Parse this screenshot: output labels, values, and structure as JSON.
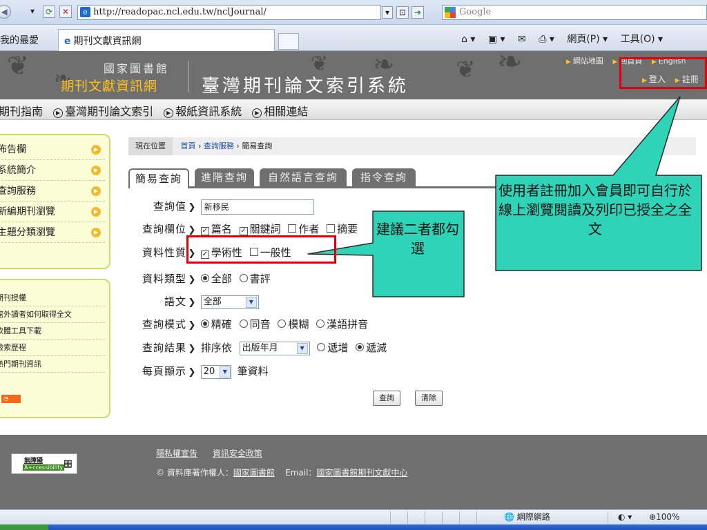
{
  "browser": {
    "url": "http://readopac.ncl.edu.tw/nclJournal/",
    "search_placeholder": "Google",
    "favorites_label": "我的最愛",
    "tab_title": "期刊文獻資訊網",
    "page_menu": "網頁(P) ▾",
    "tools_menu": "工具(O) ▾"
  },
  "header": {
    "library_name": "國家圖書館",
    "subtitle": "期刊文獻資訊網",
    "system_title": "臺灣期刊論文索引系統",
    "top_links": [
      "網站地圖",
      "回首頁",
      "English"
    ],
    "login_links": [
      "登入",
      "註冊"
    ]
  },
  "menu": [
    "期刊指南",
    "臺灣期刊論文索引",
    "報紙資訊系統",
    "相關連結"
  ],
  "sidebar": {
    "primary": [
      "佈告欄",
      "系統簡介",
      "查詢服務",
      "新編期刊瀏覽",
      "主題分類瀏覽"
    ],
    "secondary": [
      "期刊授權",
      "館外讀者如何取得全文",
      "軟體工具下載",
      "檢索歷程",
      "熱門期刊資訊"
    ],
    "rss": "RSS"
  },
  "breadcrumb": {
    "label": "現在位置",
    "path": [
      "首頁",
      "查詢服務",
      "簡易查詢"
    ]
  },
  "search_tabs": [
    "簡易查詢",
    "進階查詢",
    "自然語言查詢",
    "指令查詢"
  ],
  "form": {
    "query": {
      "label": "查詢值",
      "value": "新移民"
    },
    "fields": {
      "label": "查詢欄位",
      "options": [
        {
          "text": "篇名",
          "checked": true
        },
        {
          "text": "關鍵詞",
          "checked": true
        },
        {
          "text": "作者",
          "checked": false
        },
        {
          "text": "摘要",
          "checked": false
        }
      ]
    },
    "nature": {
      "label": "資料性質",
      "options": [
        {
          "text": "學術性",
          "checked": true
        },
        {
          "text": "一般性",
          "checked": false
        }
      ]
    },
    "type": {
      "label": "資料類型",
      "options": [
        {
          "text": "全部",
          "checked": true
        },
        {
          "text": "書評",
          "checked": false
        }
      ]
    },
    "language": {
      "label": "語文",
      "value": "全部"
    },
    "mode": {
      "label": "查詢模式",
      "options": [
        {
          "text": "精確",
          "checked": true
        },
        {
          "text": "同音",
          "checked": false
        },
        {
          "text": "模糊",
          "checked": false
        },
        {
          "text": "漢語拼音",
          "checked": false
        }
      ]
    },
    "sort": {
      "label": "查詢結果",
      "prefix": "排序依",
      "value": "出版年月",
      "options": [
        {
          "text": "遞增",
          "checked": false
        },
        {
          "text": "遞減",
          "checked": true
        }
      ]
    },
    "per_page": {
      "label": "每頁顯示",
      "value": "20",
      "suffix": "筆資料"
    },
    "submit": "查詢",
    "clear": "清除"
  },
  "footer": {
    "accessibility": [
      "無障礙",
      "A+ccessibility"
    ],
    "links": [
      "隱私權宣告",
      "資訊安全政策"
    ],
    "copyright_prefix": "© 資料庫著作權人：",
    "copyright_owner": "國家圖書館",
    "email_prefix": "Email：",
    "email_link": "國家圖書館期刊文獻中心"
  },
  "status_bar": {
    "zone": "網際網路",
    "zoom": "100%"
  },
  "annotations": {
    "login_note": "使用者註冊加入會員即可自行於線上瀏覽閱讀及列印已授全之全文",
    "nature_note": "建議二者都勾選",
    "color_fill": "#2fd3b8",
    "color_highlight": "#e0000a"
  }
}
